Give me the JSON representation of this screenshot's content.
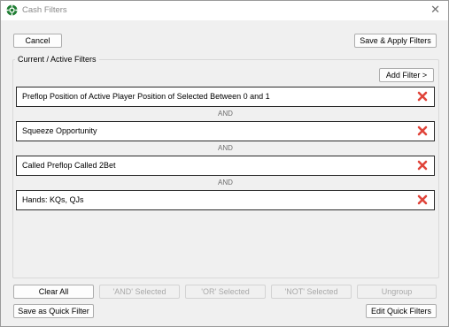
{
  "window": {
    "title": "Cash Filters"
  },
  "top_buttons": {
    "cancel": "Cancel",
    "save_apply": "Save & Apply Filters"
  },
  "group": {
    "title": "Current / Active Filters",
    "add_filter": "Add Filter >"
  },
  "filters": [
    {
      "text": "Preflop Position of Active Player Position of Selected Between 0 and  1"
    },
    {
      "text": "Squeeze Opportunity"
    },
    {
      "text": "Called Preflop Called 2Bet"
    },
    {
      "text": "Hands: KQs, QJs"
    }
  ],
  "connectors": [
    "AND",
    "AND",
    "AND"
  ],
  "bottom_buttons": {
    "clear_all": "Clear All",
    "and_selected": "'AND' Selected",
    "or_selected": "'OR' Selected",
    "not_selected": "'NOT' Selected",
    "ungroup": "Ungroup",
    "save_quick": "Save as Quick Filter",
    "edit_quick": "Edit Quick Filters"
  },
  "colors": {
    "delete_icon": "#e0443a",
    "app_icon": "#1e7d32"
  },
  "icons": {
    "app": "poker-chip-icon",
    "close": "close-icon",
    "delete": "delete-x-icon"
  }
}
